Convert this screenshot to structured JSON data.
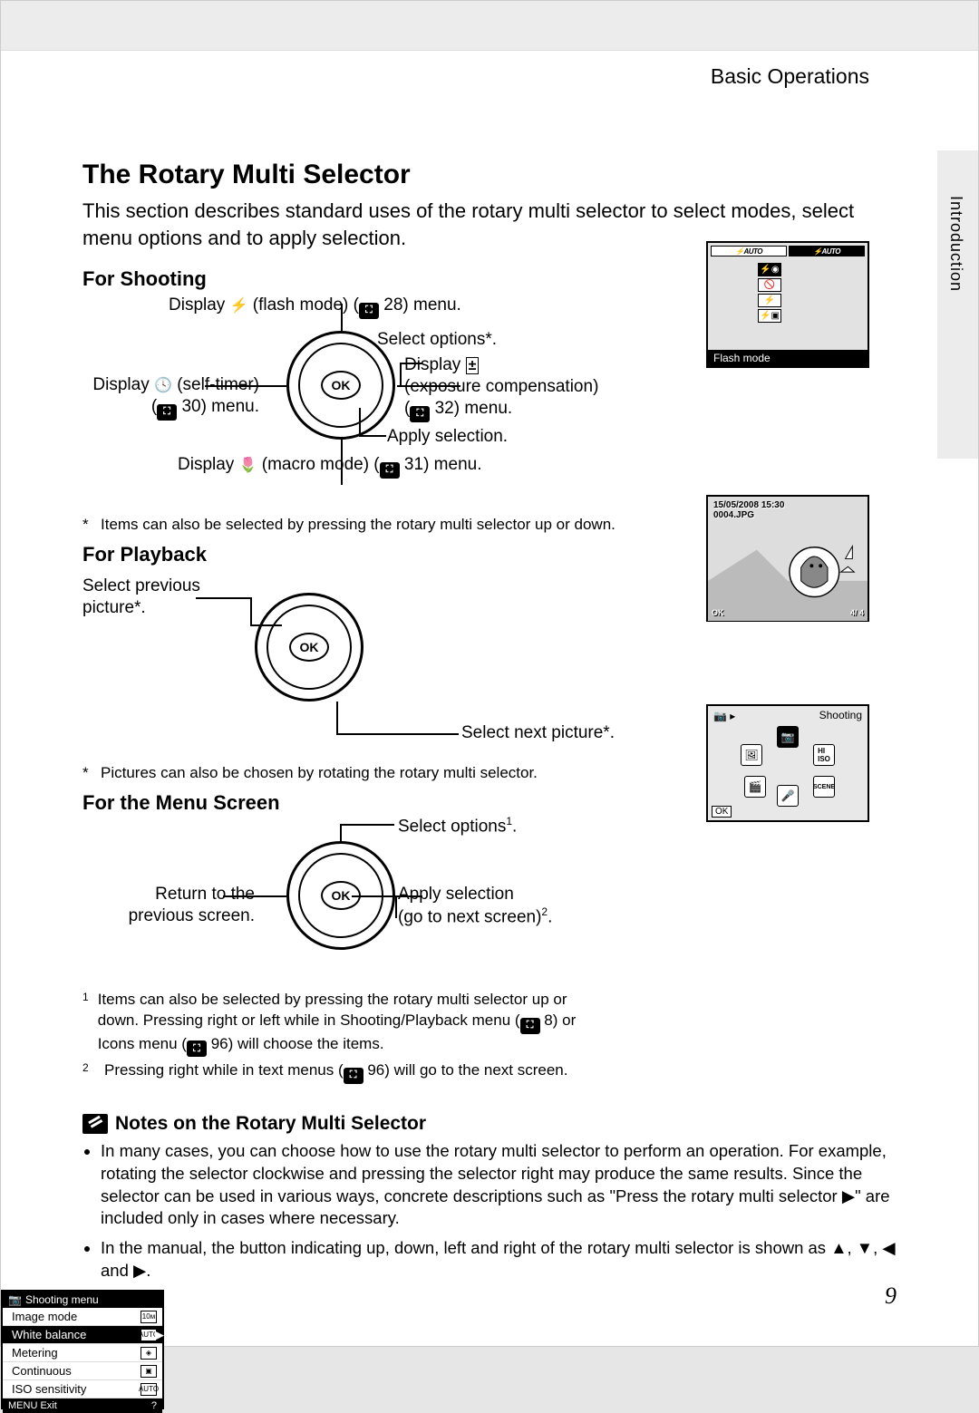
{
  "header": {
    "section": "Basic Operations"
  },
  "side_tab": {
    "label": "Introduction"
  },
  "title": "The Rotary Multi Selector",
  "intro": "This section describes standard uses of the rotary multi selector to select modes, select menu options and to apply selection.",
  "shooting": {
    "heading": "For Shooting",
    "top": {
      "prefix": "Display ",
      "mode": "(flash mode) (",
      "page": "28",
      "suffix": ") menu."
    },
    "right_sel": "Select options*.",
    "right_exp": {
      "line1": "Display",
      "line2": "(exposure compensation)",
      "page": "32",
      "suffix": ") menu."
    },
    "left": {
      "line1": "Display",
      "mode": "(self-timer)",
      "page": "30",
      "suffix": ") menu."
    },
    "bottom_apply": "Apply selection.",
    "bottom_macro": {
      "prefix": "Display ",
      "mode": "(macro mode) (",
      "page": "31",
      "suffix": ") menu."
    },
    "footnote": "Items can also be selected by pressing the rotary multi selector up or down."
  },
  "playback": {
    "heading": "For Playback",
    "left": "Select previous picture*.",
    "right": "Select next picture*.",
    "footnote": "Pictures can also be chosen by rotating the rotary multi selector.",
    "screen": {
      "datetime": "15/05/2008 15:30",
      "file": "0004.JPG",
      "bot_left": "OK",
      "bot_right": "4/   4"
    }
  },
  "menuscreen": {
    "heading": "For the Menu Screen",
    "top": "Select options",
    "left": {
      "l1": "Return to the",
      "l2": "previous screen."
    },
    "right": {
      "l1": "Apply selection",
      "l2": "(go to next screen)"
    },
    "note1": "Items can also be selected by pressing the rotary multi selector up or down. Pressing right or left while in Shooting/Playback menu (",
    "note1_p1": "8",
    "note1_mid": ") or Icons menu (",
    "note1_p2": "96",
    "note1_end": ") will choose the items.",
    "note2": "Pressing right while in text menus (",
    "note2_p": "96",
    "note2_end": ") will go to the next screen.",
    "wheel_screen": {
      "title": "Shooting",
      "ok": "OK",
      "positions": [
        "📷",
        "ISO",
        "SCENE",
        "🎤",
        "🎬",
        "📷"
      ]
    },
    "list_screen": {
      "title": "Shooting menu",
      "items": [
        "Image mode",
        "White balance",
        "Metering",
        "Continuous",
        "ISO sensitivity"
      ],
      "footer_l": "MENU Exit",
      "footer_r": "?"
    }
  },
  "flash_screen": {
    "auto1": "⚡AUTO",
    "auto2": "⚡AUTO",
    "label": "Flash mode"
  },
  "notes": {
    "title": "Notes on the Rotary Multi Selector",
    "b1": "In many cases, you can choose how to use the rotary multi selector to perform an operation. For example, rotating the selector clockwise and pressing the selector right may produce the same results. Since the selector can be used in various ways, concrete descriptions such as \"Press the rotary multi selector ▶\" are included only in cases where necessary.",
    "b2": "In the manual, the button indicating up, down, left and right of the rotary multi selector is shown as ▲, ▼, ◀ and ▶."
  },
  "page_number": "9",
  "ok_label": "OK"
}
